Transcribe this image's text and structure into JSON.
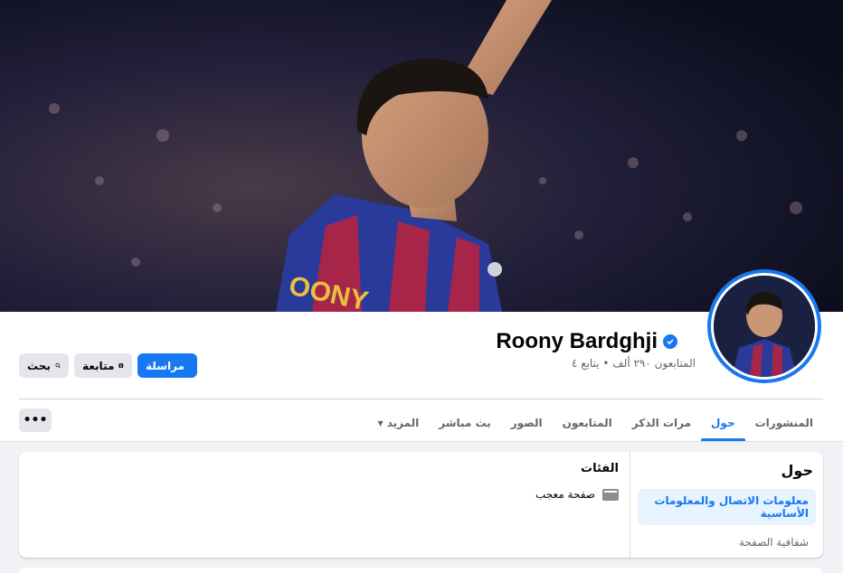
{
  "profile": {
    "name": "Roony Bardghji",
    "stats": "المتابعون ٢٩٠ ألف • يتابع ٤"
  },
  "actions": {
    "message_label": "مراسلة",
    "follow_label": "متابعة",
    "search_label": "بحث"
  },
  "tabs": [
    {
      "label": "المنشورات"
    },
    {
      "label": "حول"
    },
    {
      "label": "مرات الذكر"
    },
    {
      "label": "المتابعون"
    },
    {
      "label": "الصور"
    },
    {
      "label": "بث مباشر"
    },
    {
      "label": "المزيد"
    }
  ],
  "more_button": "•••",
  "about": {
    "title": "حول",
    "items": [
      {
        "label": "معلومات الاتصال والمعلومات الأساسية"
      },
      {
        "label": "شفافية الصفحة"
      }
    ],
    "categories_title": "الفئات",
    "category": "صفحة معجب"
  },
  "colors": {
    "accent": "#1877f2",
    "background": "#f0f2f5",
    "secondary_button": "#e4e6eb"
  },
  "icons": [
    "messenger-icon",
    "follow-icon",
    "search-icon",
    "verified-badge-icon",
    "chevron-down-icon",
    "category-icon"
  ]
}
